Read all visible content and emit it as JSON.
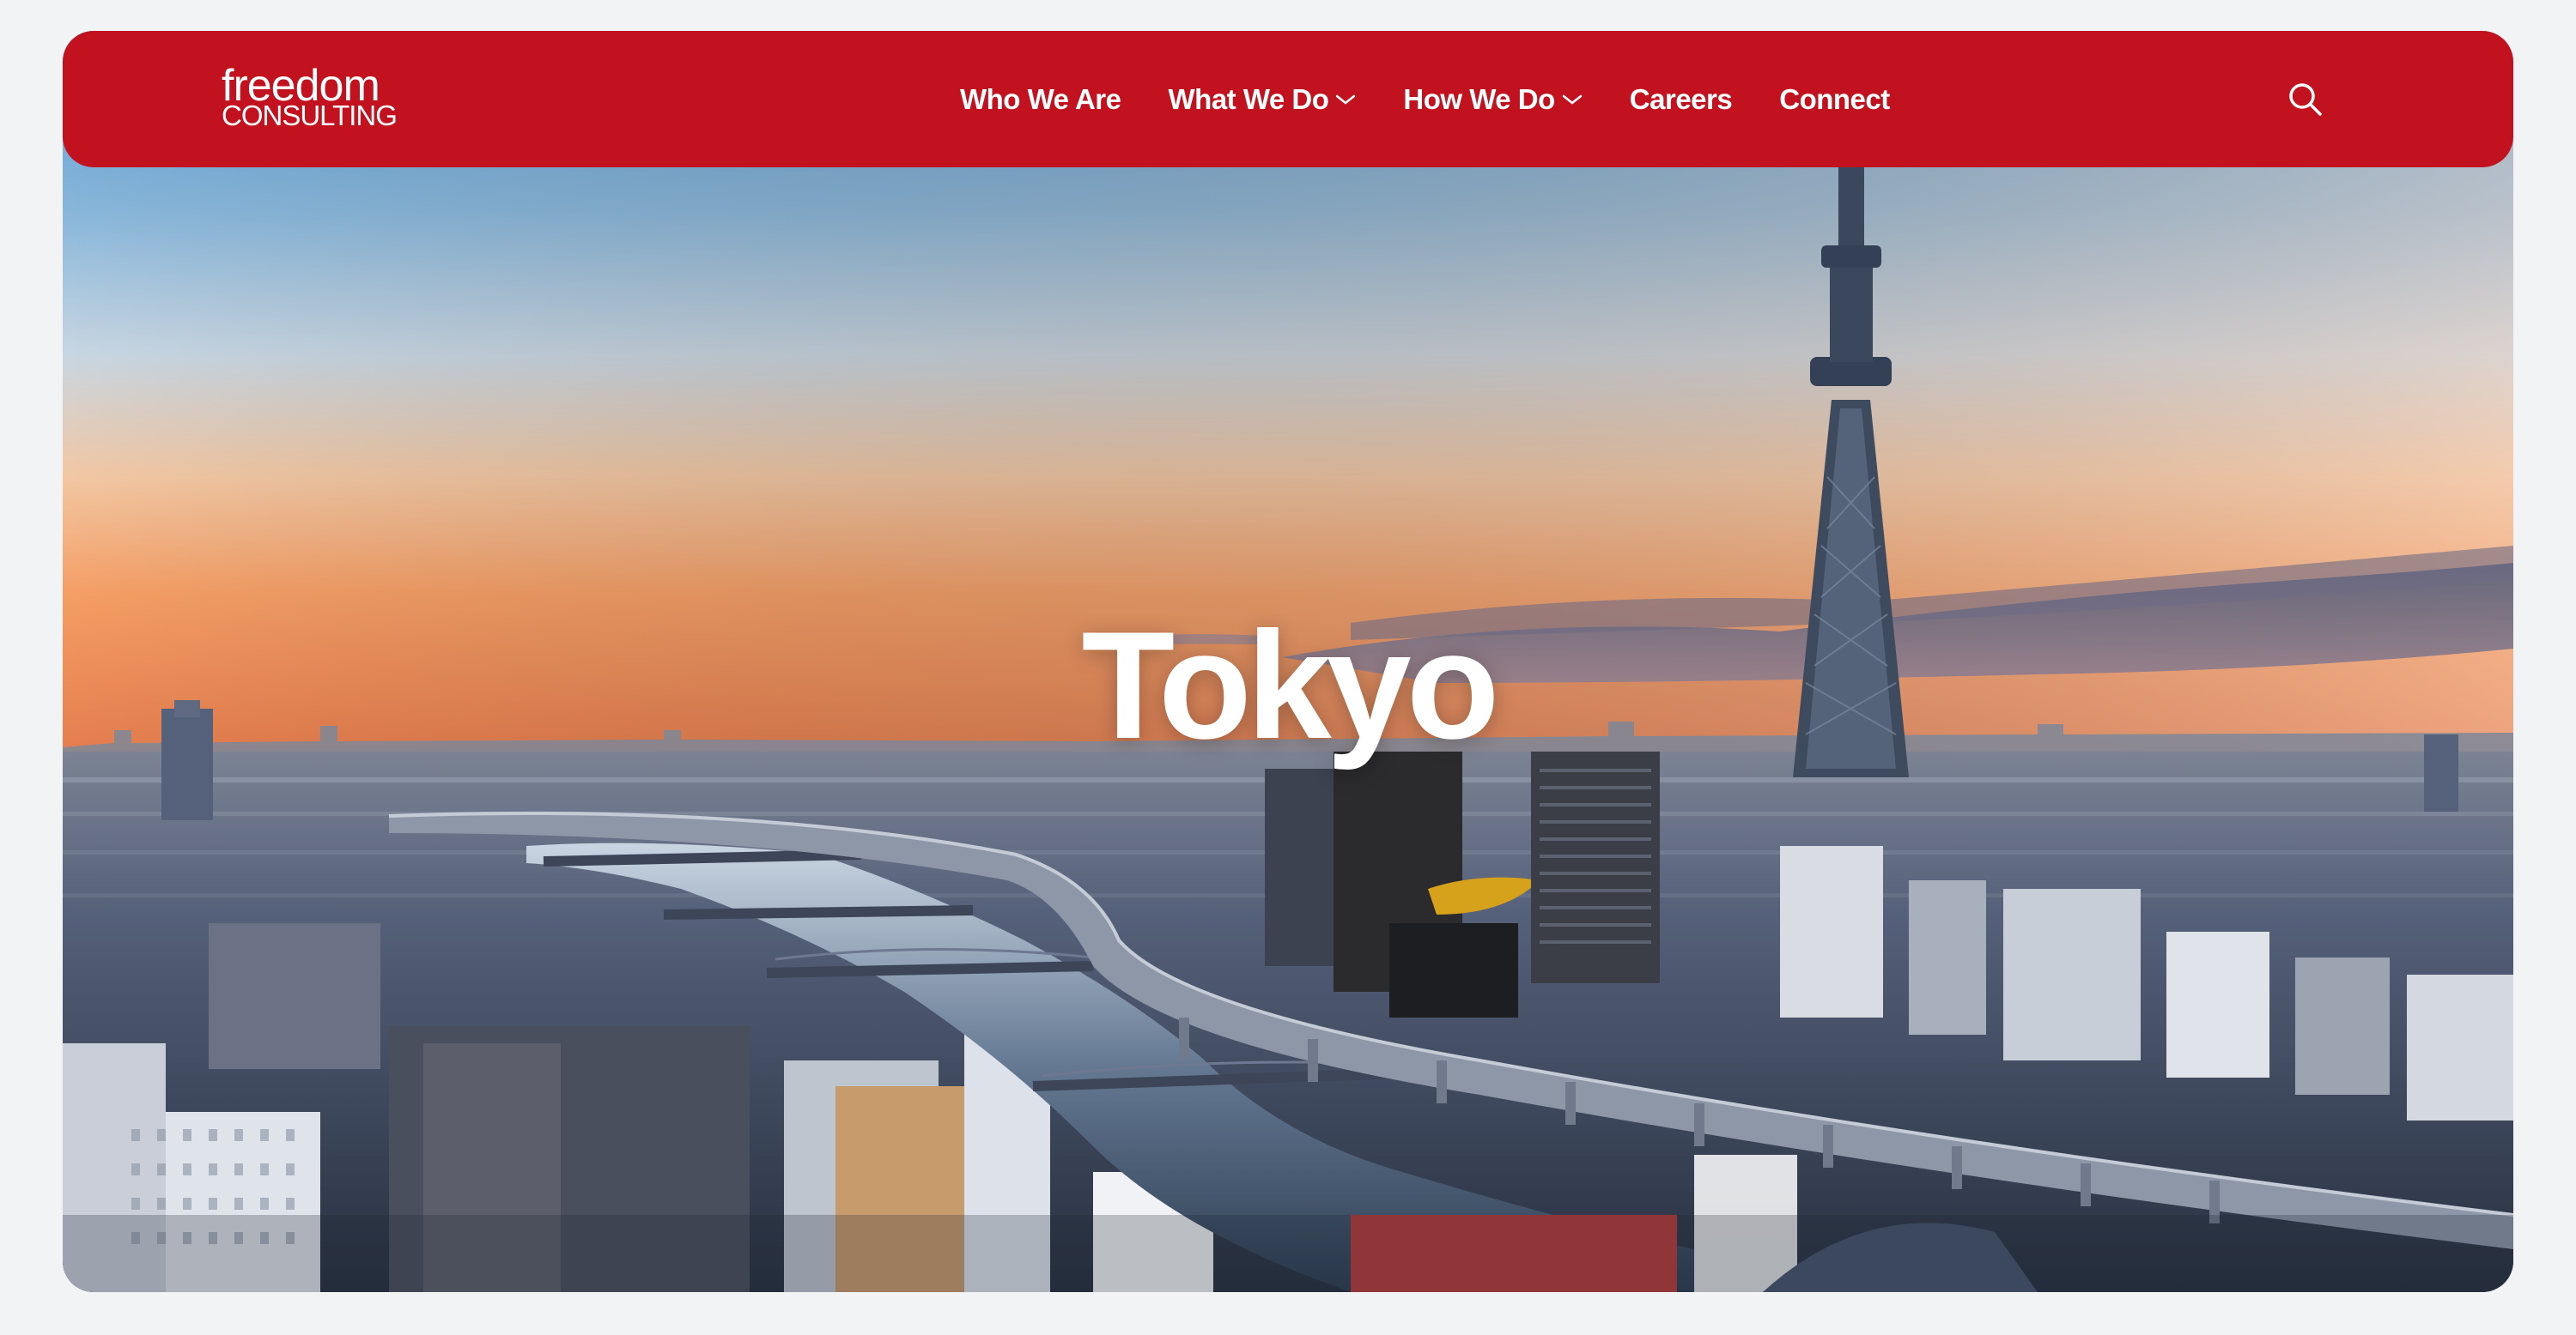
{
  "brand": {
    "logo_line1": "freedom",
    "logo_line2": "CONSULTING"
  },
  "nav": {
    "items": [
      {
        "label": "Who We Are",
        "has_dropdown": false
      },
      {
        "label": "What We Do",
        "has_dropdown": true
      },
      {
        "label": "How We Do",
        "has_dropdown": true
      },
      {
        "label": "Careers",
        "has_dropdown": false
      },
      {
        "label": "Connect",
        "has_dropdown": false
      }
    ]
  },
  "search": {
    "icon": "search-icon"
  },
  "hero": {
    "title": "Tokyo",
    "image_subject": "Tokyo skyline at sunset with Skytree tower and Sumida river"
  },
  "colors": {
    "nav_background": "#c3121f",
    "page_background": "#f2f3f5",
    "text_on_nav": "#ffffff"
  }
}
